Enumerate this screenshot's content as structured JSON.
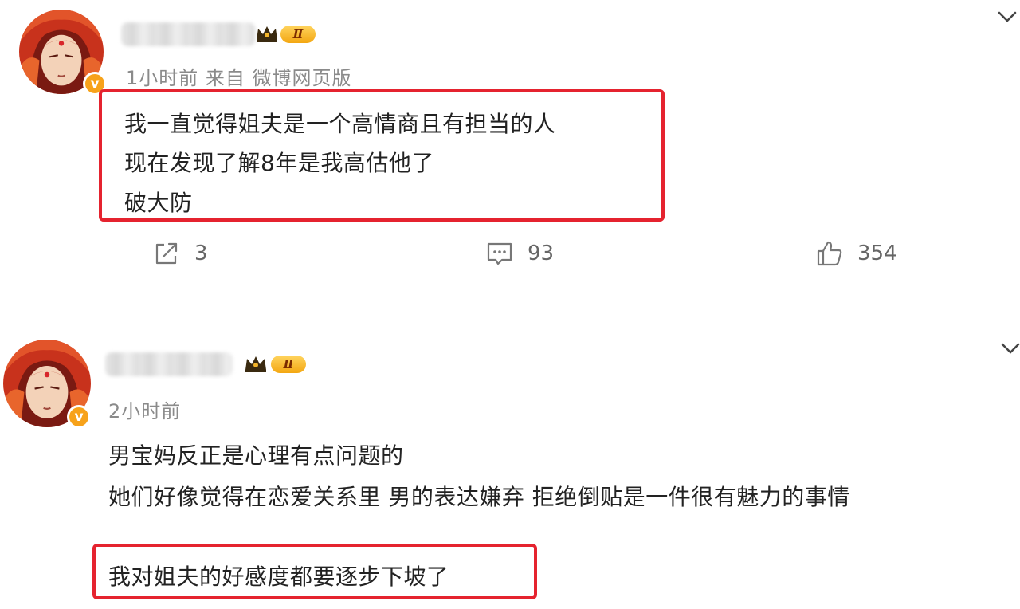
{
  "posts": [
    {
      "time_source": "1小时前  来自  微博网页版",
      "level": "Ⅱ",
      "content": [
        "我一直觉得姐夫是一个高情商且有担当的人",
        "现在发现了解8年是我高估他了",
        "破大防"
      ],
      "actions": {
        "share_count": "3",
        "comment_count": "93",
        "like_count": "354"
      },
      "verified_mark": "v"
    },
    {
      "time_source": "2小时前",
      "level": "Ⅱ",
      "content": [
        "男宝妈反正是心理有点问题的",
        "她们好像觉得在恋爱关系里 男的表达嫌弃  拒绝倒贴是一件很有魅力的事情",
        "我对姐夫的好感度都要逐步下坡了"
      ],
      "verified_mark": "v"
    }
  ],
  "icons": {
    "share": "share-icon",
    "comment": "comment-icon",
    "like": "thumbs-up-icon",
    "menu": "chevron-down-icon",
    "crown": "crown-icon"
  },
  "colors": {
    "highlight": "#e5232f",
    "verified": "#f7a21a",
    "meta_text": "#8a8a8a"
  }
}
